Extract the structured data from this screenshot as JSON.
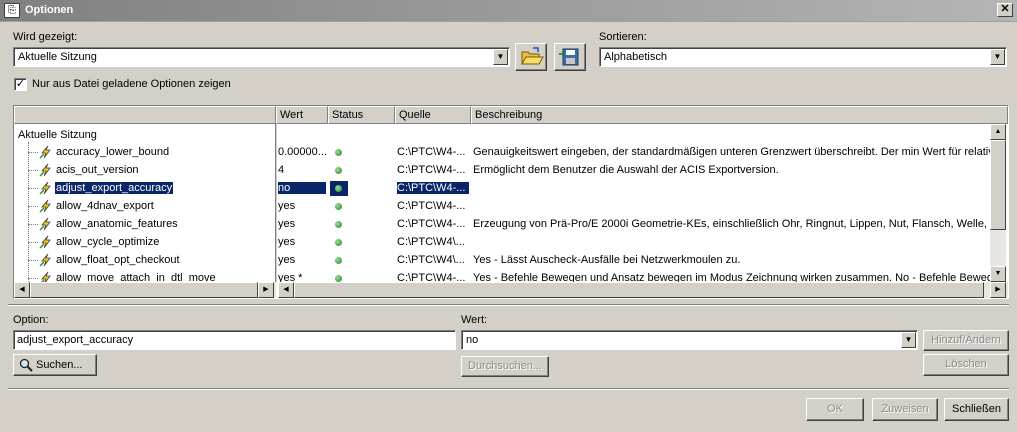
{
  "window": {
    "title": "Optionen",
    "close_glyph": "✕"
  },
  "shown": {
    "label": "Wird gezeigt:",
    "value": "Aktuelle Sitzung"
  },
  "sort": {
    "label": "Sortieren:",
    "value": "Alphabetisch"
  },
  "toolbar": {
    "open_icon": "folder-open-icon",
    "save_icon": "save-icon"
  },
  "filter": {
    "checked": true,
    "label": "Nur aus Datei geladene Optionen zeigen"
  },
  "table": {
    "columns": [
      "Wert",
      "Status",
      "Quelle",
      "Beschreibung"
    ],
    "root": "Aktuelle Sitzung",
    "rows": [
      {
        "name": "accuracy_lower_bound",
        "value": "0.00000...",
        "source": "C:\\PTC\\W4-...",
        "desc": "Genauigkeitswert eingeben, der standardmäßigen unteren Grenzwert überschreibt. Der min Wert für relative Ge"
      },
      {
        "name": "acis_out_version",
        "value": "4",
        "source": "C:\\PTC\\W4-...",
        "desc": "Ermöglicht dem Benutzer die Auswahl der ACIS Exportversion."
      },
      {
        "name": "adjust_export_accuracy",
        "value": "no",
        "source": "C:\\PTC\\W4-...",
        "desc": "",
        "selected": true
      },
      {
        "name": "allow_4dnav_export",
        "value": "yes",
        "source": "C:\\PTC\\W4-...",
        "desc": ""
      },
      {
        "name": "allow_anatomic_features",
        "value": "yes",
        "source": "C:\\PTC\\W4-...",
        "desc": "Erzeugung von Prä-Pro/E 2000i Geometrie-KEs, einschließlich  Ohr, Ringnut, Lippen, Nut, Flansch, Welle, Ver"
      },
      {
        "name": "allow_cycle_optimize",
        "value": "yes",
        "source": "C:\\PTC\\W4\\...",
        "desc": ""
      },
      {
        "name": "allow_float_opt_checkout",
        "value": "yes",
        "source": "C:\\PTC\\W4\\...",
        "desc": "Yes - Lässt Auscheck-Ausfälle bei Netzwerkmoulen zu."
      },
      {
        "name": "allow_move_attach_in_dtl_move",
        "value": "yes *",
        "source": "C:\\PTC\\W4-...",
        "desc": "Yes - Befehle Bewegen und Ansatz bewegen im Modus Zeichnung wirken zusammen. No - Befehle Bewegen"
      }
    ]
  },
  "option": {
    "label": "Option:",
    "value": "adjust_export_accuracy"
  },
  "wert": {
    "label": "Wert:",
    "value": "no"
  },
  "buttons": {
    "add_change": "Hinzuf/Ändern",
    "search": "Suchen...",
    "browse": "Durchsuchen...",
    "delete": "Löschen",
    "ok": "OK",
    "apply": "Zuweisen",
    "close": "Schließen"
  },
  "colors": {
    "selection": "#0a246a",
    "status_ok": "#1e8a2a"
  }
}
